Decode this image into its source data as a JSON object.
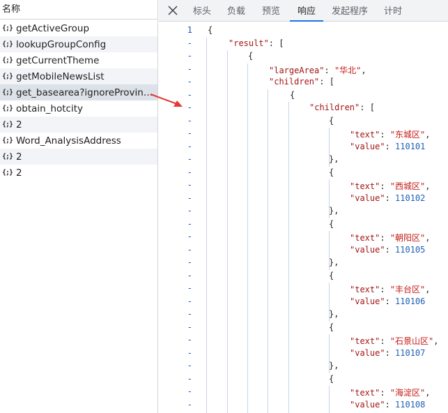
{
  "sidebar": {
    "header": "名称",
    "items": [
      {
        "icon": "{;}",
        "name": "getActiveGroup"
      },
      {
        "icon": "{;}",
        "name": "lookupGroupConfig"
      },
      {
        "icon": "{;}",
        "name": "getCurrentTheme"
      },
      {
        "icon": "{;}",
        "name": "getMobileNewsList"
      },
      {
        "icon": "{;}",
        "name": "get_basearea?ignoreProvince..."
      },
      {
        "icon": "{;}",
        "name": "obtain_hotcity"
      },
      {
        "icon": "{;}",
        "name": "2"
      },
      {
        "icon": "{;}",
        "name": "Word_AnalysisAddress"
      },
      {
        "icon": "{;}",
        "name": "2"
      },
      {
        "icon": "{;}",
        "name": "2"
      }
    ],
    "selected_index": 4
  },
  "tabs": {
    "close_icon": "close-icon",
    "items": [
      "标头",
      "负载",
      "预览",
      "响应",
      "发起程序",
      "计时"
    ],
    "active": "响应"
  },
  "code": {
    "gutter": [
      "1",
      "-",
      "-",
      "-",
      "-",
      "-",
      "-",
      "-",
      "-",
      "-",
      "-",
      "-",
      "-",
      "-",
      "-",
      "-",
      "-",
      "-",
      "-",
      "-",
      "-",
      "-",
      "-",
      "-",
      "-",
      "-",
      "-",
      "-",
      "-",
      "-",
      "-"
    ],
    "keys": {
      "result": "\"result\"",
      "largeArea": "\"largeArea\"",
      "children": "\"children\"",
      "text": "\"text\"",
      "value": "\"value\""
    },
    "largeArea_value": "\"华北\"",
    "districts": [
      {
        "text": "\"东城区\"",
        "value": "110101"
      },
      {
        "text": "\"西城区\"",
        "value": "110102"
      },
      {
        "text": "\"朝阳区\"",
        "value": "110105"
      },
      {
        "text": "\"丰台区\"",
        "value": "110106"
      },
      {
        "text": "\"石景山区\"",
        "value": "110107"
      },
      {
        "text": "\"海淀区\"",
        "value": "110108"
      }
    ]
  },
  "colors": {
    "annotation_arrow": "#e53935",
    "active_tab_underline": "#1a73e8",
    "json_key": "#a31515",
    "json_string": "#c41a16",
    "json_number": "#1c5fb8"
  }
}
